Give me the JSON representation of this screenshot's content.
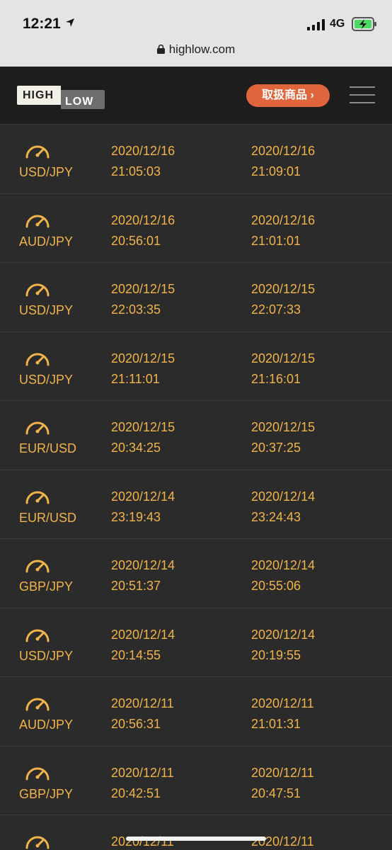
{
  "status_bar": {
    "time": "12:21",
    "network": "4G"
  },
  "browser": {
    "url": "highlow.com"
  },
  "header": {
    "logo_high": "HIGH",
    "logo_low": "LOW",
    "products_label": "取扱商品 ›"
  },
  "colors": {
    "accent": "#e0643c",
    "text_gold": "#f0b44a",
    "background": "#2b2b2b"
  },
  "trades": [
    {
      "pair": "USD/JPY",
      "open_date": "2020/12/16",
      "open_time": "21:05:03",
      "close_date": "2020/12/16",
      "close_time": "21:09:01"
    },
    {
      "pair": "AUD/JPY",
      "open_date": "2020/12/16",
      "open_time": "20:56:01",
      "close_date": "2020/12/16",
      "close_time": "21:01:01"
    },
    {
      "pair": "USD/JPY",
      "open_date": "2020/12/15",
      "open_time": "22:03:35",
      "close_date": "2020/12/15",
      "close_time": "22:07:33"
    },
    {
      "pair": "USD/JPY",
      "open_date": "2020/12/15",
      "open_time": "21:11:01",
      "close_date": "2020/12/15",
      "close_time": "21:16:01"
    },
    {
      "pair": "EUR/USD",
      "open_date": "2020/12/15",
      "open_time": "20:34:25",
      "close_date": "2020/12/15",
      "close_time": "20:37:25"
    },
    {
      "pair": "EUR/USD",
      "open_date": "2020/12/14",
      "open_time": "23:19:43",
      "close_date": "2020/12/14",
      "close_time": "23:24:43"
    },
    {
      "pair": "GBP/JPY",
      "open_date": "2020/12/14",
      "open_time": "20:51:37",
      "close_date": "2020/12/14",
      "close_time": "20:55:06"
    },
    {
      "pair": "USD/JPY",
      "open_date": "2020/12/14",
      "open_time": "20:14:55",
      "close_date": "2020/12/14",
      "close_time": "20:19:55"
    },
    {
      "pair": "AUD/JPY",
      "open_date": "2020/12/11",
      "open_time": "20:56:31",
      "close_date": "2020/12/11",
      "close_time": "21:01:31"
    },
    {
      "pair": "GBP/JPY",
      "open_date": "2020/12/11",
      "open_time": "20:42:51",
      "close_date": "2020/12/11",
      "close_time": "20:47:51"
    },
    {
      "pair": "",
      "open_date": "2020/12/11",
      "open_time": "",
      "close_date": "2020/12/11",
      "close_time": ""
    }
  ],
  "icons": {
    "row_icon": "speedometer-icon"
  }
}
